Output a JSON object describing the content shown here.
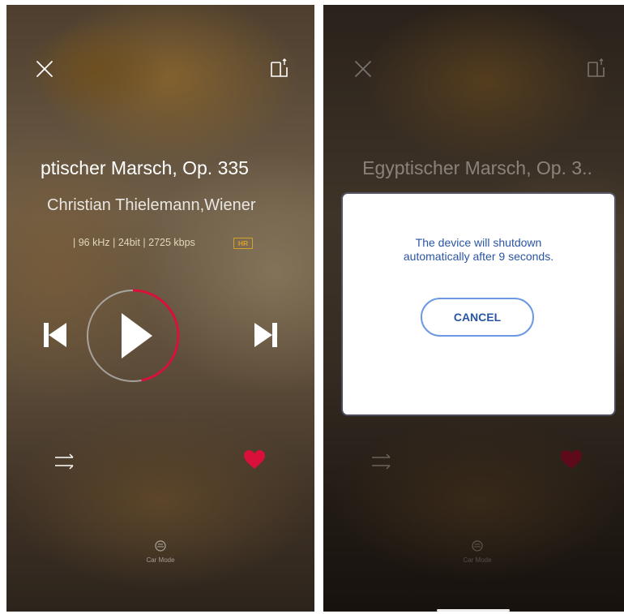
{
  "left_screen": {
    "track_title": "ptischer Marsch, Op. 335",
    "artist": "Christian Thielemann,Wiener",
    "quality_info": "| 96 kHz | 24bit | 2725 kbps",
    "hires_badge": "HR",
    "car_mode_label": "Car Mode",
    "playback_progress_fraction": 0.47,
    "favorited": true,
    "icons": [
      "close-icon",
      "share-icon",
      "skip-previous-icon",
      "play-icon",
      "skip-next-icon",
      "shuffle-icon",
      "heart-icon",
      "car-icon"
    ]
  },
  "right_screen": {
    "track_title": "Egyptischer Marsch, Op. 3..",
    "dialog": {
      "message_line1": "The device will shutdown",
      "message_line2": "automatically after 9 seconds.",
      "cancel_label": "CANCEL"
    },
    "car_mode_label": "Car Mode",
    "icons": [
      "close-icon",
      "share-icon",
      "shuffle-icon",
      "heart-icon",
      "car-icon"
    ]
  },
  "colors": {
    "accent_red": "#d8103a",
    "dialog_text": "#2a55a4",
    "button_border": "#6b9ae3",
    "hires_gold": "#d4a12a"
  }
}
